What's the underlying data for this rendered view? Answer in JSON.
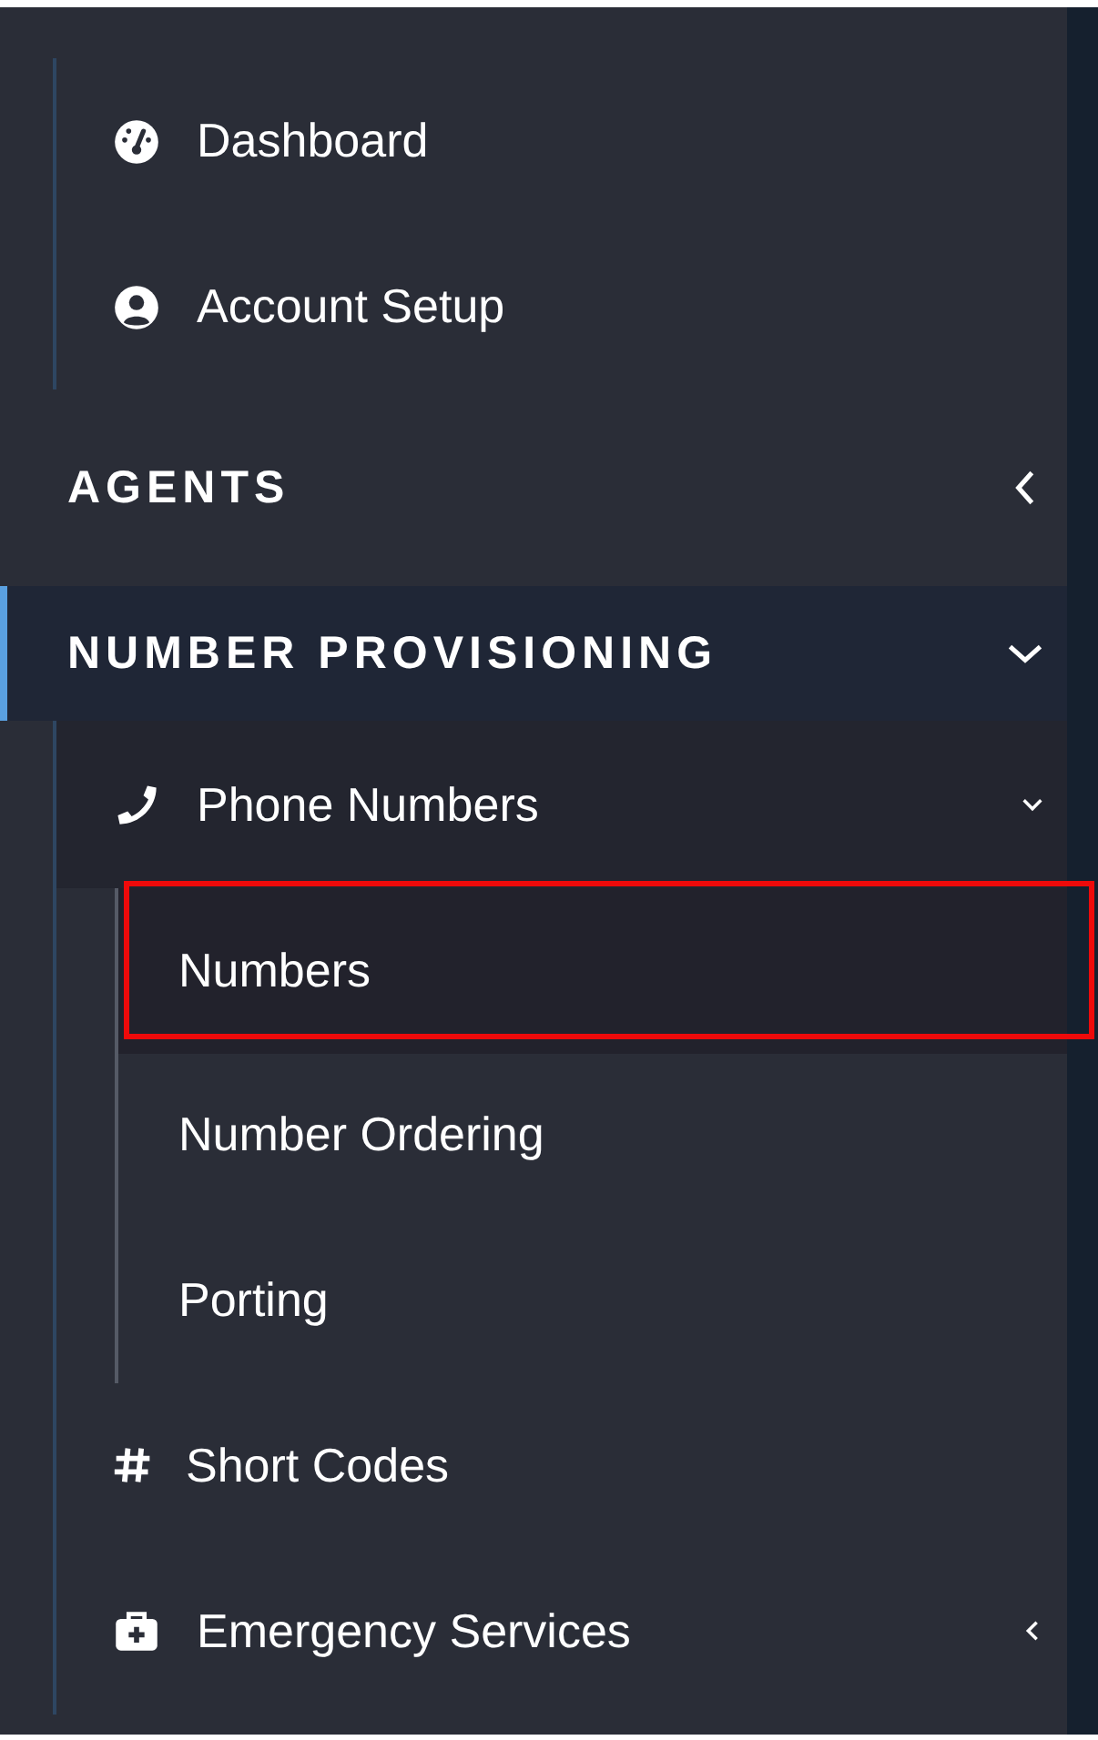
{
  "top_items": [
    {
      "label": "Dashboard"
    },
    {
      "label": "Account Setup"
    }
  ],
  "sections": [
    {
      "title": "AGENTS",
      "expanded": false,
      "selected": false
    },
    {
      "title": "NUMBER PROVISIONING",
      "expanded": true,
      "selected": true,
      "items": [
        {
          "label": "Phone Numbers",
          "expanded": true,
          "children": [
            {
              "label": "Numbers",
              "selected": true
            },
            {
              "label": "Number Ordering",
              "selected": false
            },
            {
              "label": "Porting",
              "selected": false
            }
          ]
        },
        {
          "label": "Short Codes"
        },
        {
          "label": "Emergency Services",
          "expanded": false
        }
      ]
    }
  ]
}
